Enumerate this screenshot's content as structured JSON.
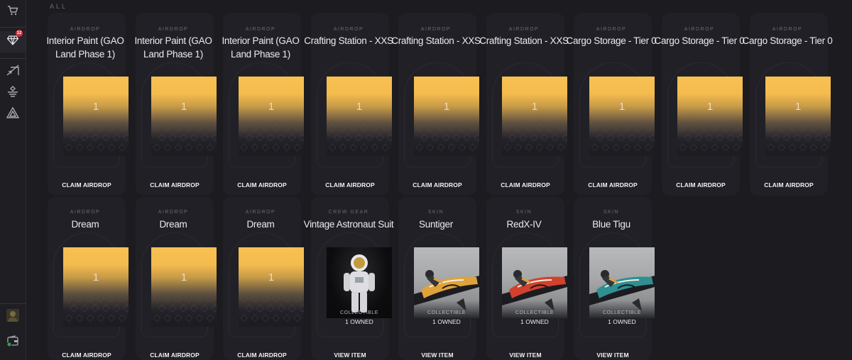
{
  "sidebar": {
    "notification_count": "12",
    "icons": [
      "cart-icon",
      "gem-icon",
      "send-icon",
      "badge-icon",
      "triangle-logo-icon",
      "avatar",
      "wallet-icon"
    ]
  },
  "section": {
    "label": "ALL"
  },
  "rows": [
    [
      {
        "category": "AIRDROP",
        "name": "Interior Paint (GAO Land Phase 1)",
        "kind": "gold",
        "qty": "1",
        "action": "CLAIM AIRDROP"
      },
      {
        "category": "AIRDROP",
        "name": "Interior Paint (GAO Land Phase 1)",
        "kind": "gold",
        "qty": "1",
        "action": "CLAIM AIRDROP"
      },
      {
        "category": "AIRDROP",
        "name": "Interior Paint (GAO Land Phase 1)",
        "kind": "gold",
        "qty": "1",
        "action": "CLAIM AIRDROP"
      },
      {
        "category": "AIRDROP",
        "name": "Crafting Station - XXS",
        "kind": "gold",
        "qty": "1",
        "action": "CLAIM AIRDROP"
      },
      {
        "category": "AIRDROP",
        "name": "Crafting Station - XXS",
        "kind": "gold",
        "qty": "1",
        "action": "CLAIM AIRDROP"
      },
      {
        "category": "AIRDROP",
        "name": "Crafting Station - XXS",
        "kind": "gold",
        "qty": "1",
        "action": "CLAIM AIRDROP"
      },
      {
        "category": "AIRDROP",
        "name": "Cargo Storage - Tier 0",
        "kind": "gold",
        "qty": "1",
        "action": "CLAIM AIRDROP"
      },
      {
        "category": "AIRDROP",
        "name": "Cargo Storage - Tier 0",
        "kind": "gold",
        "qty": "1",
        "action": "CLAIM AIRDROP"
      },
      {
        "category": "AIRDROP",
        "name": "Cargo Storage - Tier 0",
        "kind": "gold",
        "qty": "1",
        "action": "CLAIM AIRDROP"
      }
    ],
    [
      {
        "category": "AIRDROP",
        "name": "Dream",
        "kind": "gold",
        "qty": "1",
        "action": "CLAIM AIRDROP"
      },
      {
        "category": "AIRDROP",
        "name": "Dream",
        "kind": "gold",
        "qty": "1",
        "action": "CLAIM AIRDROP"
      },
      {
        "category": "AIRDROP",
        "name": "Dream",
        "kind": "gold",
        "qty": "1",
        "action": "CLAIM AIRDROP"
      },
      {
        "category": "CREW GEAR",
        "name": "Vintage Astronaut Suit",
        "kind": "suit",
        "collectible": "COLLECTIBLE",
        "owned": "1 OWNED",
        "action": "VIEW ITEM"
      },
      {
        "category": "SKIN",
        "name": "Suntiger",
        "kind": "bike",
        "accent": "#e0a23a",
        "collectible": "COLLECTIBLE",
        "owned": "1 OWNED",
        "action": "VIEW ITEM"
      },
      {
        "category": "SKIN",
        "name": "RedX-IV",
        "kind": "bike",
        "accent": "#d2412e",
        "collectible": "COLLECTIBLE",
        "owned": "1 OWNED",
        "action": "VIEW ITEM"
      },
      {
        "category": "SKIN",
        "name": "Blue Tigu",
        "kind": "bike",
        "accent": "#2f8f93",
        "collectible": "COLLECTIBLE",
        "owned": "1 OWNED",
        "action": "VIEW ITEM"
      }
    ]
  ]
}
